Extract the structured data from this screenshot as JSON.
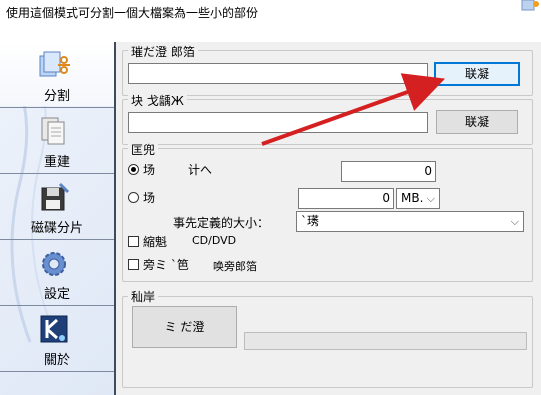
{
  "header": {
    "title": "使用這個模式可分割一個大檔案為一些小的部份",
    "icon": "app-corner-icon"
  },
  "sidebar": {
    "items": [
      {
        "label": "分割",
        "icon": "split-scissors-icon"
      },
      {
        "label": "重建",
        "icon": "rebuild-pages-icon"
      },
      {
        "label": "磁碟分片",
        "icon": "disk-split-icon"
      },
      {
        "label": "設定",
        "icon": "settings-gear-icon"
      },
      {
        "label": "關於",
        "icon": "about-k-icon"
      }
    ]
  },
  "source": {
    "group_title": "璀だ澄  郎箔",
    "value": "",
    "button_label": "联凝"
  },
  "target": {
    "group_title": "块  戈龋Ж",
    "value": "",
    "button_label": "联凝"
  },
  "options": {
    "group_title": "匡兜",
    "radio1_label": "场",
    "radio1_text": "计へ",
    "radio1_value": "0",
    "radio2_label": "场",
    "radio2_value": "0",
    "unit_value": "MB.",
    "preset_label": "事先定義的大小：",
    "preset_value": "`璓",
    "check1_label": "縮魁",
    "check1_text": "CD/DVD",
    "check2_label": "旁ミ `笆",
    "check2_text": "唤旁郎箔"
  },
  "progress": {
    "group_title": "秈岸",
    "start_label": "ミ  だ澄",
    "percent": 0
  },
  "colors": {
    "arrow": "#d42020",
    "focus": "#0078d7",
    "sidebar_bg": "#dfe8f6"
  }
}
